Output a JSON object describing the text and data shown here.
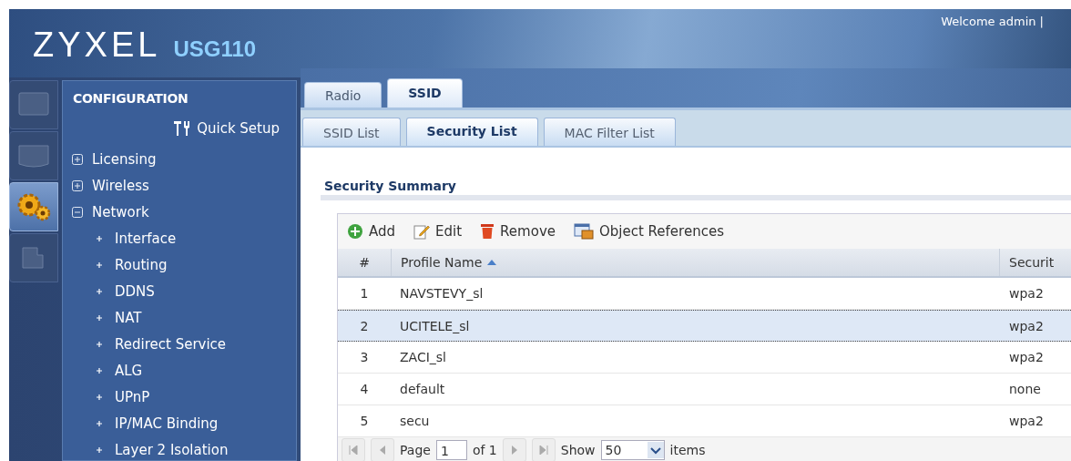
{
  "header": {
    "logo": "ZYXEL",
    "model": "USG110",
    "welcome": "Welcome admin |"
  },
  "rail": [
    {
      "kind": "dashboard",
      "selected": false
    },
    {
      "kind": "monitor",
      "selected": false
    },
    {
      "kind": "configuration",
      "selected": true
    },
    {
      "kind": "maintenance",
      "selected": false
    }
  ],
  "sidebar": {
    "title": "CONFIGURATION",
    "quick_setup": "Quick Setup",
    "items": [
      {
        "label": "Licensing",
        "expanded": false
      },
      {
        "label": "Wireless",
        "expanded": false
      },
      {
        "label": "Network",
        "expanded": true,
        "children": [
          {
            "label": "Interface"
          },
          {
            "label": "Routing"
          },
          {
            "label": "DDNS"
          },
          {
            "label": "NAT"
          },
          {
            "label": "Redirect Service"
          },
          {
            "label": "ALG"
          },
          {
            "label": "UPnP"
          },
          {
            "label": "IP/MAC Binding"
          },
          {
            "label": "Layer 2 Isolation"
          }
        ]
      }
    ]
  },
  "tabs": [
    {
      "label": "Radio",
      "selected": false
    },
    {
      "label": "SSID",
      "selected": true
    }
  ],
  "subtabs": [
    {
      "label": "SSID List",
      "selected": false
    },
    {
      "label": "Security List",
      "selected": true
    },
    {
      "label": "MAC Filter List",
      "selected": false
    }
  ],
  "section_title": "Security Summary",
  "toolbar": [
    {
      "kind": "add",
      "label": "Add"
    },
    {
      "kind": "edit",
      "label": "Edit"
    },
    {
      "kind": "remove",
      "label": "Remove"
    },
    {
      "kind": "references",
      "label": "Object References"
    }
  ],
  "table": {
    "columns": [
      {
        "label": "#",
        "sorted": false
      },
      {
        "label": "Profile Name",
        "sorted": true
      },
      {
        "label": "Securit",
        "sorted": false
      }
    ],
    "rows": [
      {
        "cells": [
          "1",
          "NAVSTEVY_sl",
          "wpa2"
        ],
        "selected": false
      },
      {
        "cells": [
          "2",
          "UCITELE_sl",
          "wpa2"
        ],
        "selected": true
      },
      {
        "cells": [
          "3",
          "ZACI_sl",
          "wpa2"
        ],
        "selected": false
      },
      {
        "cells": [
          "4",
          "default",
          "none"
        ],
        "selected": false
      },
      {
        "cells": [
          "5",
          "secu",
          "wpa2"
        ],
        "selected": false
      }
    ]
  },
  "pager": {
    "page_label": "Page",
    "page": "1",
    "of": "of 1",
    "show_label": "Show",
    "show": "50",
    "items_label": "items"
  }
}
